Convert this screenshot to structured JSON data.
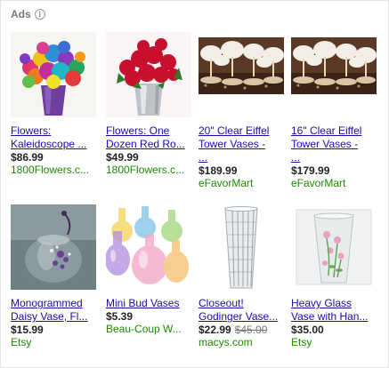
{
  "header": {
    "label": "Ads",
    "info_icon": "info-icon"
  },
  "products": [
    {
      "title_l1": "Flowers:",
      "title_l2": "Kaleidoscope ...",
      "title_l3": "",
      "price": "$86.99",
      "was": "",
      "merchant": "1800Flowers.c..."
    },
    {
      "title_l1": "Flowers: One",
      "title_l2": "Dozen Red Ro...",
      "title_l3": "",
      "price": "$49.99",
      "was": "",
      "merchant": "1800Flowers.c..."
    },
    {
      "title_l1": "20\" Clear Eiffel",
      "title_l2": "Tower Vases -",
      "title_l3": "...",
      "price": "$189.99",
      "was": "",
      "merchant": "eFavorMart"
    },
    {
      "title_l1": "16\" Clear Eiffel",
      "title_l2": "Tower Vases -",
      "title_l3": "...",
      "price": "$179.99",
      "was": "",
      "merchant": "eFavorMart"
    },
    {
      "title_l1": "Monogrammed",
      "title_l2": "Daisy Vase, Fl...",
      "title_l3": "",
      "price": "$15.99",
      "was": "",
      "merchant": "Etsy"
    },
    {
      "title_l1": "Mini Bud Vases",
      "title_l2": "",
      "title_l3": "",
      "price": "$5.39",
      "was": "",
      "merchant": "Beau-Coup W..."
    },
    {
      "title_l1": "Closeout!",
      "title_l2": "Godinger Vase...",
      "title_l3": "",
      "price": "$22.99",
      "was": "$45.00",
      "merchant": "macys.com"
    },
    {
      "title_l1": "Heavy Glass",
      "title_l2": "Vase with Han...",
      "title_l3": "",
      "price": "$35.00",
      "was": "",
      "merchant": "Etsy"
    }
  ]
}
